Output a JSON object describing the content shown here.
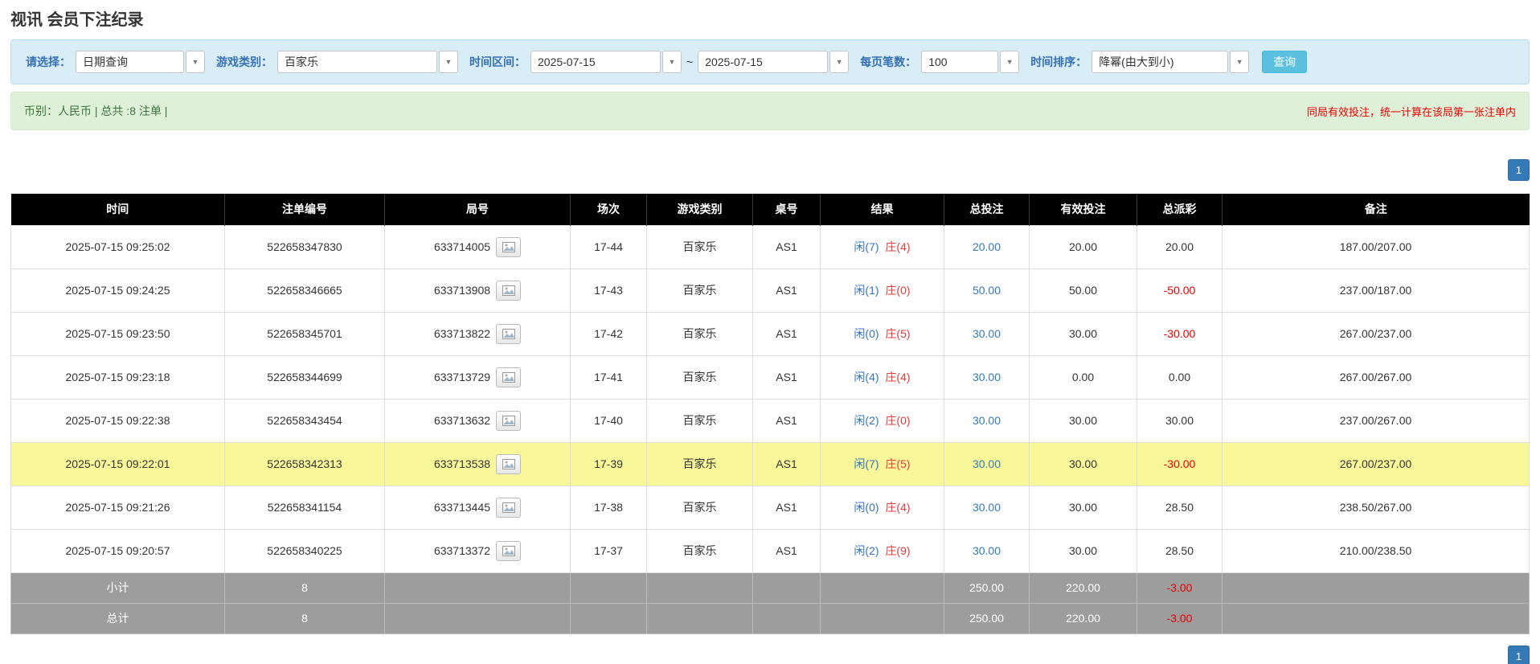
{
  "page_title": "视讯 会员下注纪录",
  "filter_bar": {
    "query_type": {
      "label": "请选择：",
      "value": "日期查询"
    },
    "game_type": {
      "label": "游戏类别：",
      "value": "百家乐"
    },
    "date_range": {
      "label": "时间区间：",
      "from": "2025-07-15",
      "separator": "~",
      "to": "2025-07-15"
    },
    "page_size": {
      "label": "每页笔数：",
      "value": "100"
    },
    "time_sort": {
      "label": "时间排序：",
      "value": "降幂(由大到小)"
    },
    "search_button_label": "查询"
  },
  "summary_bar": {
    "left_text": "币别：人民币 | 总共 :8 注单 |",
    "right_note": "同局有效投注，统一计算在该局第一张注单内"
  },
  "pagination": {
    "pages": [
      "1"
    ]
  },
  "table": {
    "headers": [
      "时间",
      "注单编号",
      "局号",
      "场次",
      "游戏类别",
      "桌号",
      "结果",
      "总投注",
      "有效投注",
      "总派彩",
      "备注"
    ],
    "header_keys": [
      "time",
      "bet-id",
      "round",
      "session",
      "game-type",
      "table-no",
      "result",
      "total-bet",
      "valid-bet",
      "payout",
      "note"
    ],
    "rows": [
      {
        "time": "2025-07-15 09:25:02",
        "bet_id": "522658347830",
        "round_id": "633714005",
        "session": "17-44",
        "game": "百家乐",
        "table_no": "AS1",
        "result_player": "闲(7)",
        "result_banker": "庄(4)",
        "total_bet": "20.00",
        "valid_bet": "20.00",
        "payout": "20.00",
        "note": "187.00/207.00",
        "highlight": false
      },
      {
        "time": "2025-07-15 09:24:25",
        "bet_id": "522658346665",
        "round_id": "633713908",
        "session": "17-43",
        "game": "百家乐",
        "table_no": "AS1",
        "result_player": "闲(1)",
        "result_banker": "庄(0)",
        "total_bet": "50.00",
        "valid_bet": "50.00",
        "payout": "-50.00",
        "note": "237.00/187.00",
        "highlight": false
      },
      {
        "time": "2025-07-15 09:23:50",
        "bet_id": "522658345701",
        "round_id": "633713822",
        "session": "17-42",
        "game": "百家乐",
        "table_no": "AS1",
        "result_player": "闲(0)",
        "result_banker": "庄(5)",
        "total_bet": "30.00",
        "valid_bet": "30.00",
        "payout": "-30.00",
        "note": "267.00/237.00",
        "highlight": false
      },
      {
        "time": "2025-07-15 09:23:18",
        "bet_id": "522658344699",
        "round_id": "633713729",
        "session": "17-41",
        "game": "百家乐",
        "table_no": "AS1",
        "result_player": "闲(4)",
        "result_banker": "庄(4)",
        "total_bet": "30.00",
        "valid_bet": "0.00",
        "payout": "0.00",
        "note": "267.00/267.00",
        "highlight": false
      },
      {
        "time": "2025-07-15 09:22:38",
        "bet_id": "522658343454",
        "round_id": "633713632",
        "session": "17-40",
        "game": "百家乐",
        "table_no": "AS1",
        "result_player": "闲(2)",
        "result_banker": "庄(0)",
        "total_bet": "30.00",
        "valid_bet": "30.00",
        "payout": "30.00",
        "note": "237.00/267.00",
        "highlight": false
      },
      {
        "time": "2025-07-15 09:22:01",
        "bet_id": "522658342313",
        "round_id": "633713538",
        "session": "17-39",
        "game": "百家乐",
        "table_no": "AS1",
        "result_player": "闲(7)",
        "result_banker": "庄(5)",
        "total_bet": "30.00",
        "valid_bet": "30.00",
        "payout": "-30.00",
        "note": "267.00/237.00",
        "highlight": true
      },
      {
        "time": "2025-07-15 09:21:26",
        "bet_id": "522658341154",
        "round_id": "633713445",
        "session": "17-38",
        "game": "百家乐",
        "table_no": "AS1",
        "result_player": "闲(0)",
        "result_banker": "庄(4)",
        "total_bet": "30.00",
        "valid_bet": "30.00",
        "payout": "28.50",
        "note": "238.50/267.00",
        "highlight": false
      },
      {
        "time": "2025-07-15 09:20:57",
        "bet_id": "522658340225",
        "round_id": "633713372",
        "session": "17-37",
        "game": "百家乐",
        "table_no": "AS1",
        "result_player": "闲(2)",
        "result_banker": "庄(9)",
        "total_bet": "30.00",
        "valid_bet": "30.00",
        "payout": "28.50",
        "note": "210.00/238.50",
        "highlight": false
      }
    ],
    "subtotal": {
      "label": "小计",
      "count": "8",
      "total_bet": "250.00",
      "valid_bet": "220.00",
      "payout": "-3.00"
    },
    "total": {
      "label": "总计",
      "count": "8",
      "total_bet": "250.00",
      "valid_bet": "220.00",
      "payout": "-3.00"
    }
  },
  "colors": {
    "accent_blue": "#337ab7",
    "player_blue": "#3374c0",
    "banker_red": "#e23b3b",
    "negative_red": "#e60000",
    "highlight_yellow": "#f8f89a",
    "search_button_blue": "#5bc0de",
    "filter_bar_bg": "#d9edf7",
    "summary_bar_bg": "#dff0d8",
    "header_bg": "#000000",
    "footer_bg": "#9d9d9d"
  },
  "icons": {
    "dropdown": "chevron-down-icon",
    "round_media": "image-icon"
  }
}
